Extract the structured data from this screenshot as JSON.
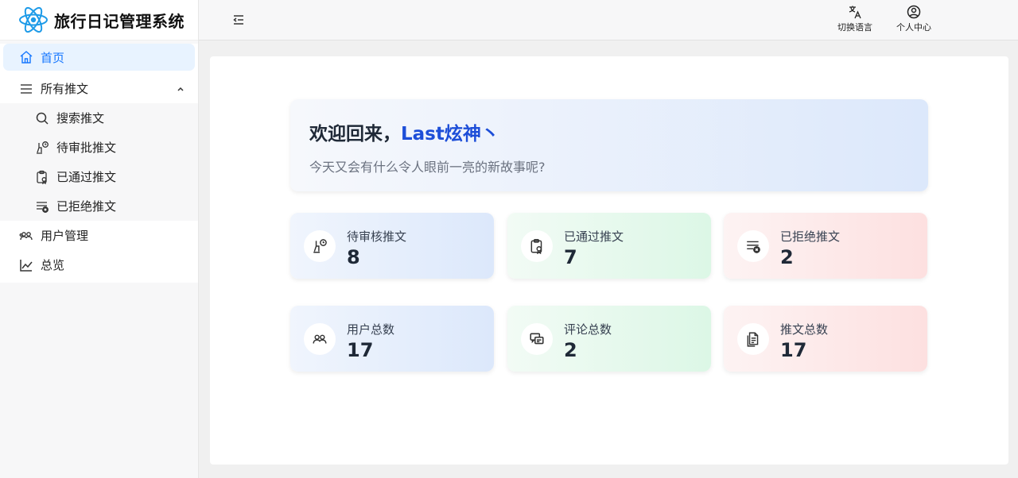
{
  "app": {
    "title": "旅行日记管理系统"
  },
  "sidebar": {
    "home": "首页",
    "all_posts": "所有推文",
    "sub_items": [
      "搜索推文",
      "待审批推文",
      "已通过推文",
      "已拒绝推文"
    ],
    "user_mgmt": "用户管理",
    "overview": "总览"
  },
  "header": {
    "language": "切换语言",
    "profile": "个人中心"
  },
  "welcome": {
    "greeting": "欢迎回来，",
    "username": "Last炫神丶",
    "subtitle": "今天又会有什么令人眼前一亮的新故事呢?"
  },
  "stats": [
    {
      "label": "待审核推文",
      "value": "8",
      "icon": "pending-review-icon",
      "color": "#dce8fb"
    },
    {
      "label": "已通过推文",
      "value": "7",
      "icon": "approved-clipboard-icon",
      "color": "#dcf7e6"
    },
    {
      "label": "已拒绝推文",
      "value": "2",
      "icon": "rejected-list-icon",
      "color": "#fde0e0"
    },
    {
      "label": "用户总数",
      "value": "17",
      "icon": "users-icon",
      "color": "#dce8fb"
    },
    {
      "label": "评论总数",
      "value": "2",
      "icon": "comments-icon",
      "color": "#dcf7e6"
    },
    {
      "label": "推文总数",
      "value": "17",
      "icon": "documents-icon",
      "color": "#fde0e0"
    }
  ],
  "colors": {
    "accent": "#1677ff",
    "username": "#1d4ed8"
  }
}
